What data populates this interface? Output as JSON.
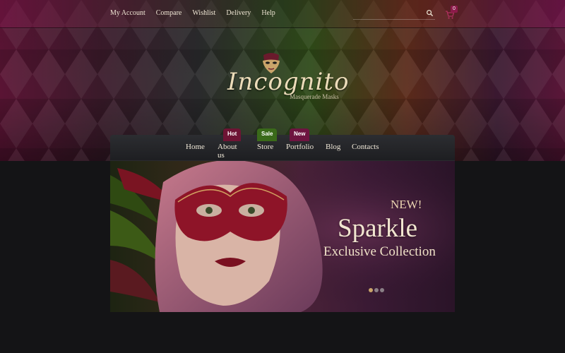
{
  "topbar": {
    "links": [
      "My Account",
      "Compare",
      "Wishlist",
      "Delivery",
      "Help"
    ],
    "search_placeholder": "",
    "cart_count": "0"
  },
  "logo": {
    "title": "Incognito",
    "subtitle": "Masquerade Masks"
  },
  "nav": {
    "items": [
      "Home",
      "About us",
      "Store",
      "Portfolio",
      "Blog",
      "Contacts"
    ],
    "badges": {
      "hot": "Hot",
      "sale": "Sale",
      "new": "New"
    }
  },
  "slider": {
    "kicker": "NEW!",
    "title": "Sparkle",
    "subtitle": "Exclusive Collection",
    "slide_count": 3,
    "active_slide": 1
  },
  "colors": {
    "accent": "#8c1a4a",
    "sale": "#3a6a1a",
    "gold": "#c9a46a"
  },
  "icons": [
    "search-icon",
    "cart-icon",
    "mask-logo-icon"
  ]
}
